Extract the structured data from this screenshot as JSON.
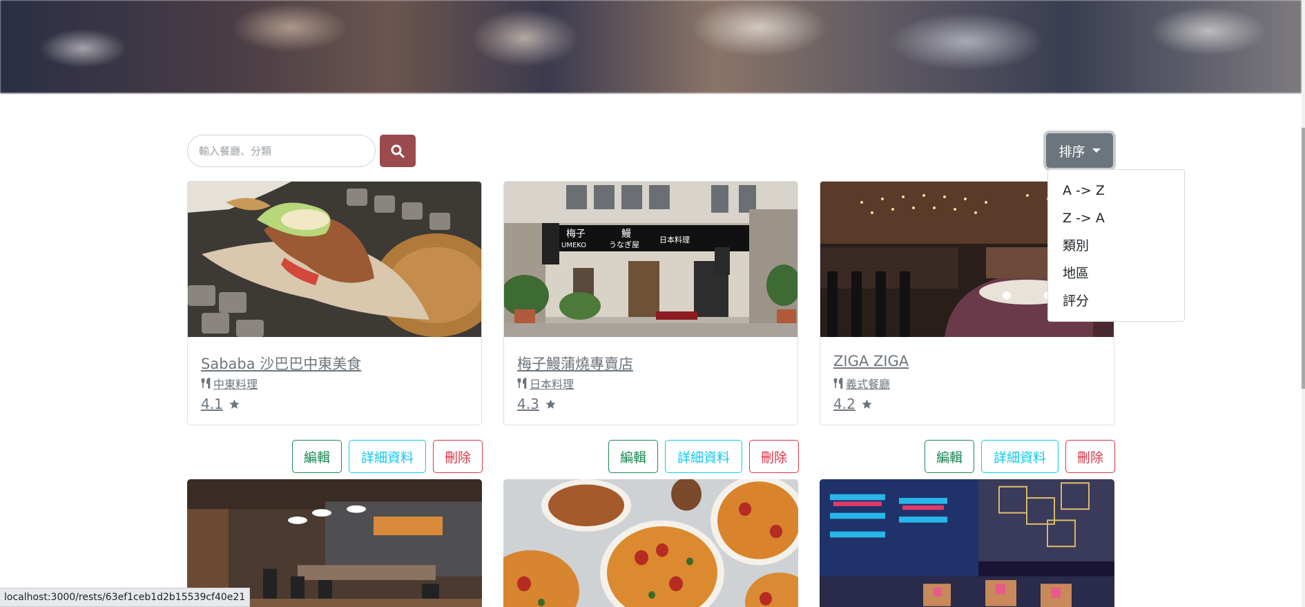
{
  "search": {
    "placeholder": "輸入餐廳、分類"
  },
  "sort": {
    "label": "排序",
    "options": [
      "A -> Z",
      "Z -> A",
      "類別",
      "地區",
      "評分"
    ]
  },
  "restaurants": [
    {
      "name": "Sababa 沙巴巴中東美食",
      "category": "中東料理",
      "rating": "4.1"
    },
    {
      "name": "梅子鰻蒲燒專賣店",
      "category": "日本料理",
      "rating": "4.3"
    },
    {
      "name": "ZIGA ZIGA",
      "category": "義式餐廳",
      "rating": "4.2"
    }
  ],
  "actions": {
    "edit": "編輯",
    "detail": "詳細資料",
    "delete": "刪除"
  },
  "store_sign": {
    "line1": "梅子",
    "line2": "UMEKO",
    "line3": "鰻",
    "line4": "うなぎ屋",
    "line5": "日本料理"
  },
  "status_url": "localhost:3000/rests/63ef1ceb1d2b15539cf40e21",
  "colors": {
    "danger": "#dc3545",
    "success": "#198754",
    "info": "#0dcaf0",
    "secondary": "#6c757d",
    "search_button": "#9b4a4d"
  }
}
